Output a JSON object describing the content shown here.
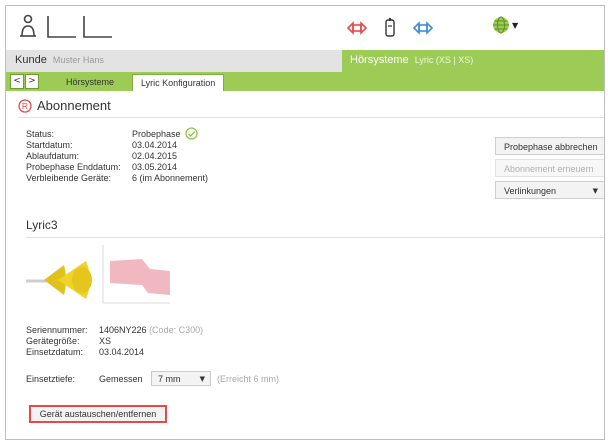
{
  "header": {
    "customer_label": "Kunde",
    "customer_name": "Muster Hans",
    "systems_label": "Hörsysteme",
    "systems_sub": "Lyric (XS | XS)"
  },
  "nav": {
    "back": "<",
    "forward": ">"
  },
  "tabs": [
    {
      "label": "Hörsysteme",
      "active": false
    },
    {
      "label": "Lyric Konfiguration",
      "active": true
    }
  ],
  "subscription": {
    "icon_letter": "R",
    "title": "Abonnement",
    "fields": [
      {
        "label": "Status:",
        "value": "Probephase"
      },
      {
        "label": "Startdatum:",
        "value": "03.04.2014"
      },
      {
        "label": "Ablaufdatum:",
        "value": "02.04.2015"
      },
      {
        "label": "Probephase Enddatum:",
        "value": "03.05.2014"
      },
      {
        "label": "Verbleibende Geräte:",
        "value": "6 (im Abonnement)"
      }
    ]
  },
  "actions": {
    "cancel_trial": "Probephase abbrechen",
    "renew": "Abonnement erneuern",
    "links": "Verlinkungen"
  },
  "device": {
    "title": "Lyric3",
    "serial_label": "Seriennummer:",
    "serial_value": "1406NY226",
    "serial_code": "(Code: C300)",
    "size_label": "Gerätegröße:",
    "size_value": "XS",
    "date_label": "Einsetzdatum:",
    "date_value": "03.04.2014",
    "depth_label": "Einsetztiefe:",
    "depth_mode": "Gemessen",
    "depth_select": "7 mm",
    "depth_reached": "(Erreicht 6 mm)",
    "replace_button": "Gerät austauschen/entfernen"
  },
  "colors": {
    "green": "#9ccc55",
    "red_accent": "#e44a4a",
    "blue_accent": "#3f8fd6",
    "device_yellow": "#f0d22a",
    "ear_pink": "#f2b8c2"
  }
}
